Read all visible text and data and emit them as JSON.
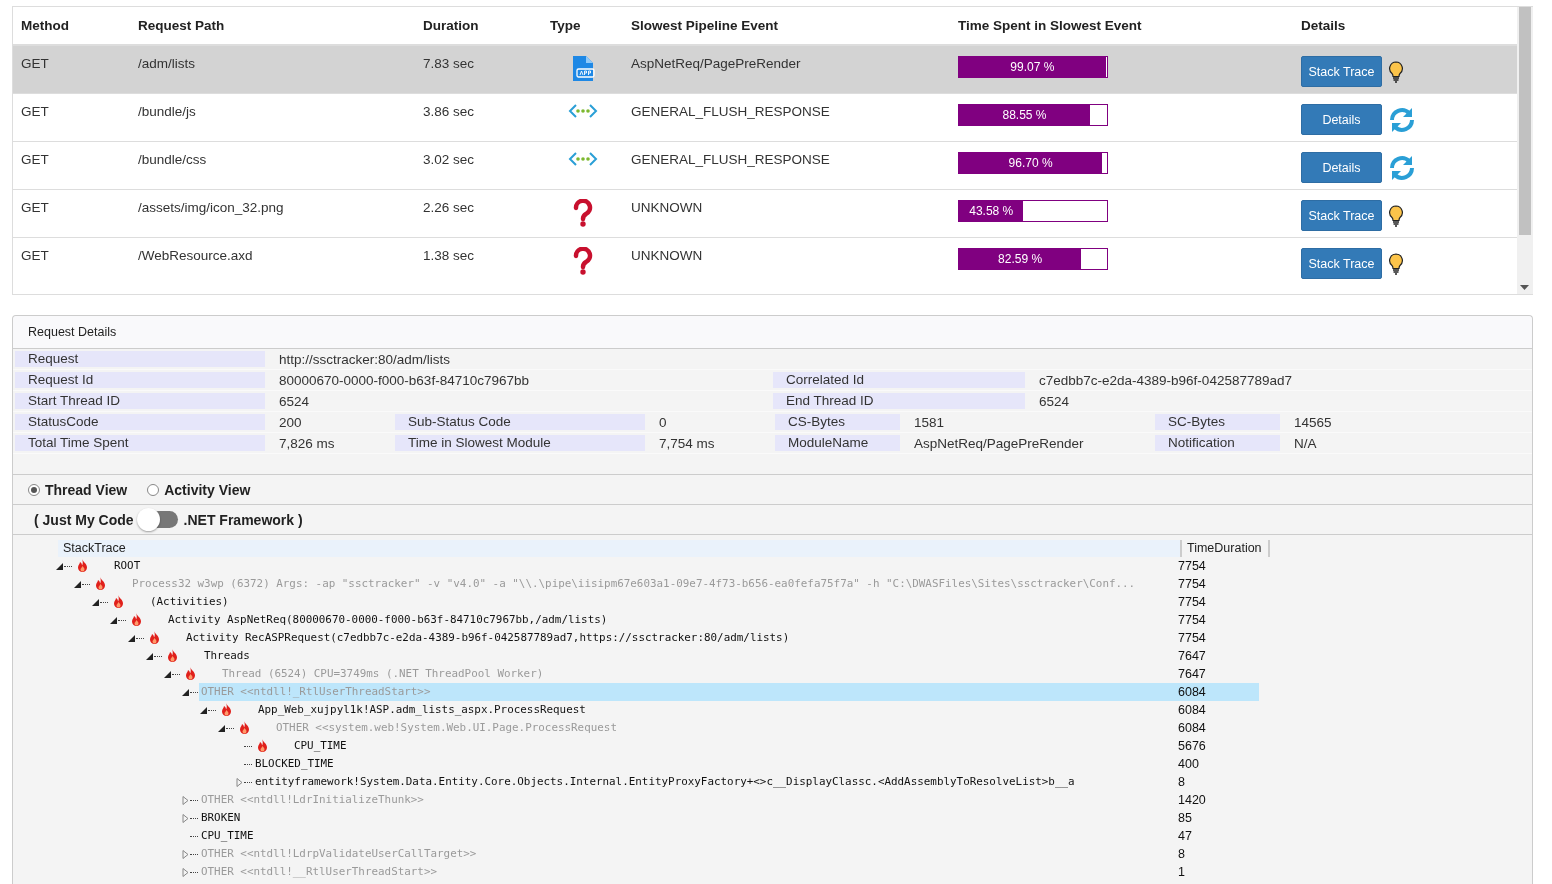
{
  "requests": {
    "columns": [
      "Method",
      "Request Path",
      "Duration",
      "Type",
      "Slowest Pipeline Event",
      "Time Spent in Slowest Event",
      "Details"
    ],
    "rows": [
      {
        "method": "GET",
        "path": "/adm/lists",
        "duration": "7.83 sec",
        "type_icon": {
          "kind": "app"
        },
        "event": "AspNetReq/PagePreRender",
        "level": 0.9907,
        "percent": "99.07 %",
        "button": "Stack Trace",
        "detail_icon": {
          "kind": "bulb"
        },
        "selected": true
      },
      {
        "method": "GET",
        "path": "/bundle/js",
        "duration": "3.86 sec",
        "type_icon": {
          "kind": "flush"
        },
        "event": "GENERAL_FLUSH_RESPONSE",
        "level": 0.8855,
        "percent": "88.55 %",
        "button": "Details",
        "detail_icon": {
          "kind": "refresh"
        },
        "selected": false
      },
      {
        "method": "GET",
        "path": "/bundle/css",
        "duration": "3.02 sec",
        "type_icon": {
          "kind": "flush"
        },
        "event": "GENERAL_FLUSH_RESPONSE",
        "level": 0.967,
        "percent": "96.70 %",
        "button": "Details",
        "detail_icon": {
          "kind": "refresh"
        },
        "selected": false
      },
      {
        "method": "GET",
        "path": "/assets/img/icon_32.png",
        "duration": "2.26 sec",
        "type_icon": {
          "kind": "unknown"
        },
        "event": "UNKNOWN",
        "level": 0.4358,
        "percent": "43.58 %",
        "button": "Stack Trace",
        "detail_icon": {
          "kind": "bulb"
        },
        "selected": false
      },
      {
        "method": "GET",
        "path": "/WebResource.axd",
        "duration": "1.38 sec",
        "type_icon": {
          "kind": "unknown"
        },
        "event": "UNKNOWN",
        "level": 0.8259,
        "percent": "82.59 %",
        "button": "Stack Trace",
        "detail_icon": {
          "kind": "bulb"
        },
        "selected": false
      }
    ]
  },
  "request_details": {
    "title": "Request Details",
    "rows": [
      {
        "kind": "wide",
        "fields": [
          {
            "label": "Request",
            "value": "http://ssctracker:80/adm/lists"
          }
        ]
      },
      {
        "kind": "wide",
        "fields": [
          {
            "label": "Request Id",
            "value": "80000670-0000-f000-b63f-84710c7967bb"
          },
          {
            "label": "Correlated Id",
            "value": "c7edbb7c-e2da-4389-b96f-042587789ad7"
          }
        ]
      },
      {
        "kind": "wide",
        "fields": [
          {
            "label": "Start Thread ID",
            "value": "6524"
          },
          {
            "label": "End Thread ID",
            "value": "6524"
          }
        ]
      },
      {
        "kind": "quad",
        "fields": [
          {
            "label": "StatusCode",
            "value": "200"
          },
          {
            "label": "Sub-Status Code",
            "value": "0"
          },
          {
            "label": "CS-Bytes",
            "value": "1581"
          },
          {
            "label": "SC-Bytes",
            "value": "14565"
          }
        ]
      },
      {
        "kind": "quad",
        "fields": [
          {
            "label": "Total Time Spent",
            "value": "7,826 ms"
          },
          {
            "label": "Time in Slowest Module",
            "value": "7,754 ms"
          },
          {
            "label": "ModuleName",
            "value": "AspNetReq/PagePreRender"
          },
          {
            "label": "Notification",
            "value": "N/A"
          }
        ]
      }
    ]
  },
  "views": {
    "options": [
      {
        "label": "Thread View",
        "selected": true
      },
      {
        "label": "Activity View",
        "selected": false
      }
    ],
    "toggle": {
      "left": "( Just My Code",
      "right": ".NET Framework )",
      "on": false
    }
  },
  "trace": {
    "columns": [
      "StackTrace",
      "TimeDuration"
    ],
    "nodes": [
      {
        "name": "ROOT",
        "time": "7754",
        "kind": "branch",
        "expanded": true,
        "hot": true,
        "muted": false,
        "selected": false,
        "children": [
          {
            "name": "Process32 w3wp (6372) Args: -ap \"ssctracker\" -v \"v4.0\" -a \"\\\\.\\pipe\\iisipm67e603a1-09e7-4f73-b656-ea0fefa75f7a\" -h \"C:\\DWASFiles\\Sites\\ssctracker\\Conf...",
            "time": "7754",
            "kind": "branch",
            "expanded": true,
            "hot": true,
            "muted": true,
            "selected": false,
            "children": [
              {
                "name": "(Activities)",
                "time": "7754",
                "kind": "branch",
                "expanded": true,
                "hot": true,
                "muted": false,
                "selected": false,
                "children": [
                  {
                    "name": "Activity AspNetReq(80000670-0000-f000-b63f-84710c7967bb,/adm/lists)",
                    "time": "7754",
                    "kind": "branch",
                    "expanded": true,
                    "hot": true,
                    "muted": false,
                    "selected": false,
                    "children": [
                      {
                        "name": "Activity RecASPRequest(c7edbb7c-e2da-4389-b96f-042587789ad7,https://ssctracker:80/adm/lists)",
                        "time": "7754",
                        "kind": "branch",
                        "expanded": true,
                        "hot": true,
                        "muted": false,
                        "selected": false,
                        "children": [
                          {
                            "name": "Threads",
                            "time": "7647",
                            "kind": "branch",
                            "expanded": true,
                            "hot": true,
                            "muted": false,
                            "selected": false,
                            "children": [
                              {
                                "name": "Thread (6524) CPU=3749ms (.NET ThreadPool Worker)",
                                "time": "7647",
                                "kind": "branch",
                                "expanded": true,
                                "hot": true,
                                "muted": true,
                                "selected": false,
                                "children": [
                                  {
                                    "name": "OTHER <<ntdll!_RtlUserThreadStart>>",
                                    "time": "6084",
                                    "kind": "branch",
                                    "expanded": true,
                                    "hot": false,
                                    "muted": true,
                                    "selected": true,
                                    "children": [
                                      {
                                        "name": "App_Web_xujpyl1k!ASP.adm_lists_aspx.ProcessRequest",
                                        "time": "6084",
                                        "kind": "branch",
                                        "expanded": true,
                                        "hot": true,
                                        "muted": false,
                                        "selected": false,
                                        "children": [
                                          {
                                            "name": "OTHER <<system.web!System.Web.UI.Page.ProcessRequest",
                                            "time": "6084",
                                            "kind": "branch",
                                            "expanded": true,
                                            "hot": true,
                                            "muted": true,
                                            "selected": false,
                                            "children": [
                                              {
                                                "name": "CPU_TIME",
                                                "time": "5676",
                                                "kind": "leaf",
                                                "hot": true,
                                                "muted": false,
                                                "selected": false
                                              },
                                              {
                                                "name": "BLOCKED_TIME",
                                                "time": "400",
                                                "kind": "leaf",
                                                "hot": false,
                                                "muted": false,
                                                "selected": false
                                              },
                                              {
                                                "name": "entityframework!System.Data.Entity.Core.Objects.Internal.EntityProxyFactory+<>c__DisplayClassc.<AddAssemblyToResolveList>b__a",
                                                "time": "8",
                                                "kind": "branch",
                                                "expanded": false,
                                                "hot": false,
                                                "muted": false,
                                                "selected": false
                                              }
                                            ]
                                          }
                                        ]
                                      }
                                    ]
                                  },
                                  {
                                    "name": "OTHER <<ntdll!LdrInitializeThunk>>",
                                    "time": "1420",
                                    "kind": "branch",
                                    "expanded": false,
                                    "hot": false,
                                    "muted": true,
                                    "selected": false
                                  },
                                  {
                                    "name": "BROKEN",
                                    "time": "85",
                                    "kind": "branch",
                                    "expanded": false,
                                    "hot": false,
                                    "muted": false,
                                    "selected": false
                                  },
                                  {
                                    "name": "CPU_TIME",
                                    "time": "47",
                                    "kind": "leaf",
                                    "hot": false,
                                    "muted": false,
                                    "selected": false
                                  },
                                  {
                                    "name": "OTHER <<ntdll!LdrpValidateUserCallTarget>>",
                                    "time": "8",
                                    "kind": "branch",
                                    "expanded": false,
                                    "hot": false,
                                    "muted": true,
                                    "selected": false
                                  },
                                  {
                                    "name": "OTHER <<ntdll!__RtlUserThreadStart>>",
                                    "time": "1",
                                    "kind": "branch",
                                    "expanded": false,
                                    "hot": false,
                                    "muted": true,
                                    "selected": false
                                  }
                                ]
                              }
                            ]
                          }
                        ]
                      }
                    ]
                  }
                ]
              }
            ]
          }
        ]
      }
    ]
  }
}
